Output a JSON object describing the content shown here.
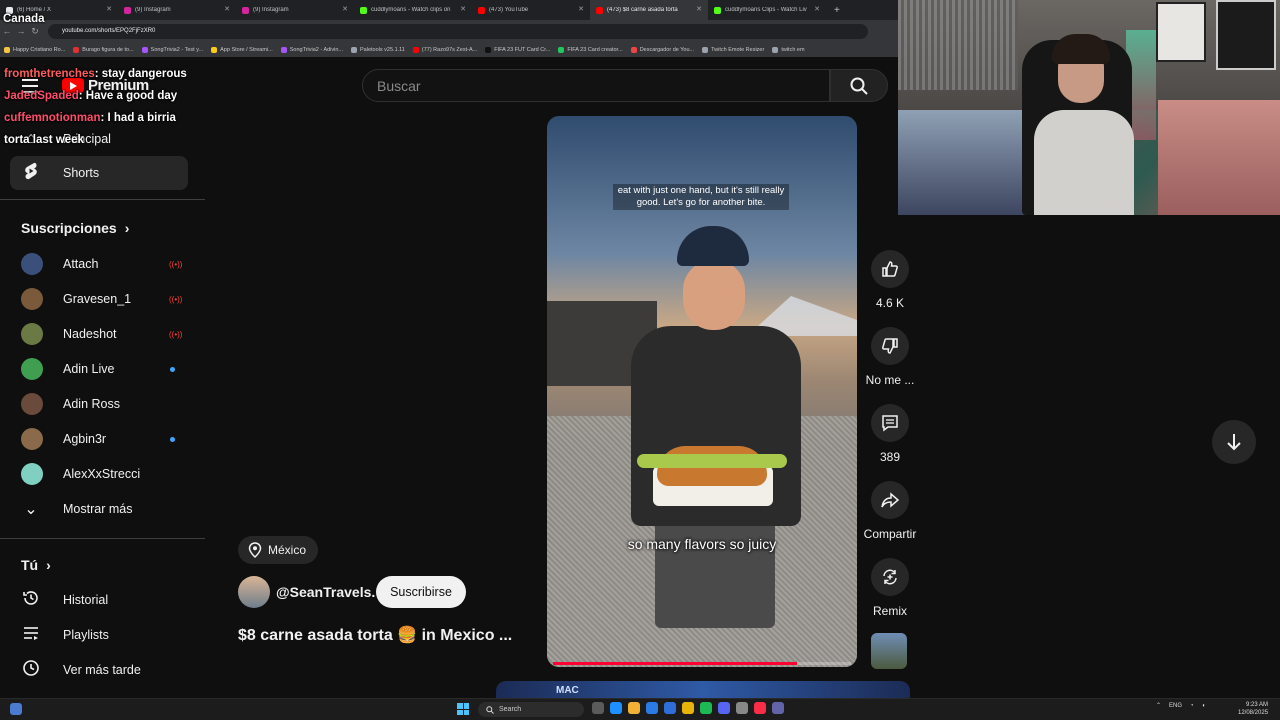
{
  "browser": {
    "tabs": [
      {
        "title": "(6) Home / X",
        "color": "#e7e9ea",
        "active": false
      },
      {
        "title": "(9) Instagram",
        "color": "#d6249f",
        "active": false
      },
      {
        "title": "(9) Instagram",
        "color": "#d6249f",
        "active": false
      },
      {
        "title": "cuddlymoans - Watch clips on",
        "color": "#53fc18",
        "active": false
      },
      {
        "title": "(473) YouTube",
        "color": "#ff0000",
        "active": false
      },
      {
        "title": "(473) $8 carne asada torta",
        "color": "#ff0000",
        "active": true
      },
      {
        "title": "cuddlymoans Clips - Watch Liv",
        "color": "#53fc18",
        "active": false
      }
    ],
    "url": "youtube.com/shorts/EPQ2FjFzXR0",
    "bookmarks": [
      {
        "label": "Happy Cristiano Ro...",
        "color": "#f4c542"
      },
      {
        "label": "Burago figura de to...",
        "color": "#e03131"
      },
      {
        "label": "SongTrivia2 - Test y...",
        "color": "#a855f7"
      },
      {
        "label": "App Store / Streami...",
        "color": "#facc15"
      },
      {
        "label": "SongTrivia2 - Adivin...",
        "color": "#a855f7"
      },
      {
        "label": "Paletools v25.1.11",
        "color": "#9ca3af"
      },
      {
        "label": "(77) Razo97s Zest-A...",
        "color": "#ff0000"
      },
      {
        "label": "FIFA 23 FUT Card Cr...",
        "color": "#111111"
      },
      {
        "label": "FIFA 23 Card creator...",
        "color": "#22c55e"
      },
      {
        "label": "Descargador de You...",
        "color": "#ef4444"
      },
      {
        "label": "Twitch Emote Resizer",
        "color": "#9ca3af"
      },
      {
        "label": "twitch em",
        "color": "#9ca3af"
      }
    ]
  },
  "chat": {
    "region": "Canada",
    "messages": [
      {
        "user": "fromthetrenches",
        "text": ": stay dangerous"
      },
      {
        "user": "JadedSpaded",
        "text": ": Have a good day"
      },
      {
        "user": "cuffemnotionman",
        "text": ": I had a birria"
      },
      {
        "user": "",
        "text": "torta last week"
      }
    ]
  },
  "youtube": {
    "logo_text": "Premium",
    "search_placeholder": "Buscar",
    "nav": {
      "home": "Principal",
      "shorts": "Shorts"
    },
    "subscriptions_title": "Suscripciones",
    "subscriptions": [
      {
        "name": "Attach",
        "status": "live",
        "avatar": "#3a4f7a"
      },
      {
        "name": "Gravesen_1",
        "status": "live",
        "avatar": "#7a5a3a"
      },
      {
        "name": "Nadeshot",
        "status": "live",
        "avatar": "#6b7a45"
      },
      {
        "name": "Adin Live",
        "status": "new",
        "avatar": "#3f9e4f"
      },
      {
        "name": "Adin Ross",
        "status": "",
        "avatar": "#6a4a3a"
      },
      {
        "name": "Agbin3r",
        "status": "new",
        "avatar": "#8a6a4a"
      },
      {
        "name": "AlexXxStrecci",
        "status": "",
        "avatar": "#7fd0c0"
      }
    ],
    "show_more": "Mostrar más",
    "you_title": "Tú",
    "you_items": [
      {
        "label": "Historial",
        "icon": "history-icon"
      },
      {
        "label": "Playlists",
        "icon": "playlists-icon"
      },
      {
        "label": "Ver más tarde",
        "icon": "watch-later-icon"
      }
    ]
  },
  "short": {
    "caption_top": "eat with just one hand, but it's still really good. Let's go for another bite.",
    "caption_bottom": "so many flavors so juicy",
    "progress": 0.82,
    "location": "México",
    "channel": "@SeanTravels.",
    "subscribe": "Suscribirse",
    "title": "$8 carne asada torta 🍔 in Mexico ...",
    "actions": {
      "like_count": "4.6 K",
      "dislike_label": "No me ...",
      "comments_count": "389",
      "share_label": "Compartir",
      "remix_label": "Remix"
    },
    "next_peek_text": "MAC"
  },
  "taskbar": {
    "search": "Search",
    "lang": "ENG",
    "time": "9:23 AM",
    "date": "12/08/2025"
  }
}
